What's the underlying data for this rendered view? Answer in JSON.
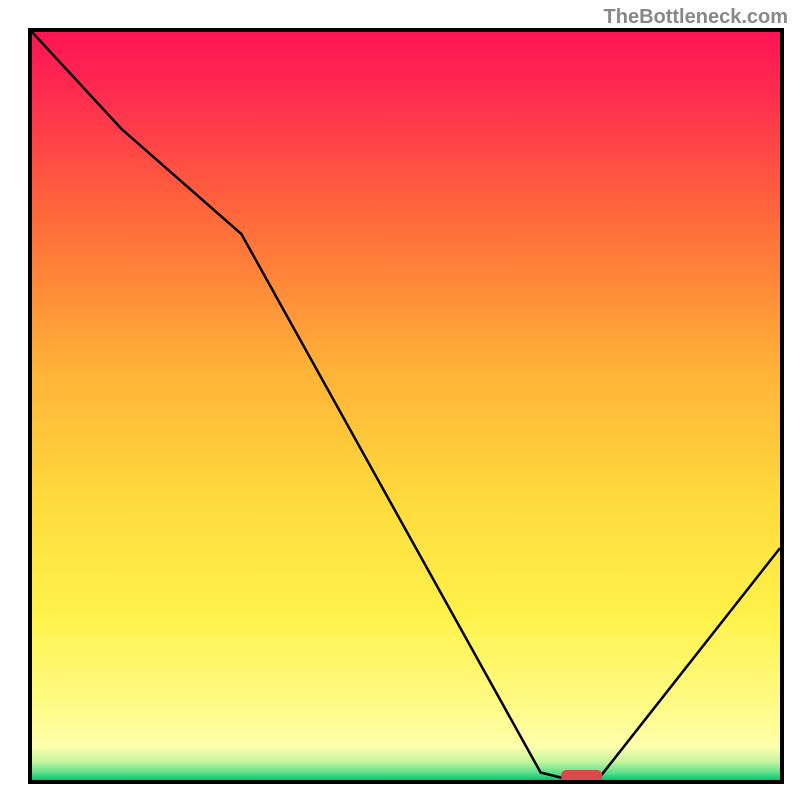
{
  "watermark": "TheBottleneck.com",
  "chart_data": {
    "type": "line",
    "title": "",
    "xlabel": "",
    "ylabel": "",
    "xlim": [
      0,
      100
    ],
    "ylim": [
      0,
      100
    ],
    "grid": false,
    "legend": false,
    "gradient_stops": [
      {
        "offset": 0,
        "color": "#ff1455"
      },
      {
        "offset": 0.08,
        "color": "#ff2b4f"
      },
      {
        "offset": 0.25,
        "color": "#ff6a3a"
      },
      {
        "offset": 0.45,
        "color": "#ffb238"
      },
      {
        "offset": 0.62,
        "color": "#ffd93c"
      },
      {
        "offset": 0.78,
        "color": "#fff24a"
      },
      {
        "offset": 0.9,
        "color": "#fffb86"
      },
      {
        "offset": 0.955,
        "color": "#fdffac"
      },
      {
        "offset": 0.975,
        "color": "#c7f6a0"
      },
      {
        "offset": 0.99,
        "color": "#5fe08c"
      },
      {
        "offset": 1.0,
        "color": "#00c86e"
      }
    ],
    "series": [
      {
        "name": "bottleneck-curve",
        "x": [
          0,
          12,
          28,
          68,
          72,
          76,
          100
        ],
        "values": [
          100,
          87,
          73,
          1,
          0,
          0.5,
          31
        ]
      }
    ],
    "marker": {
      "name": "optimal-range",
      "x_center": 73.5,
      "y_value": 0,
      "width_pct": 5.5,
      "color": "#d94a4a"
    }
  }
}
